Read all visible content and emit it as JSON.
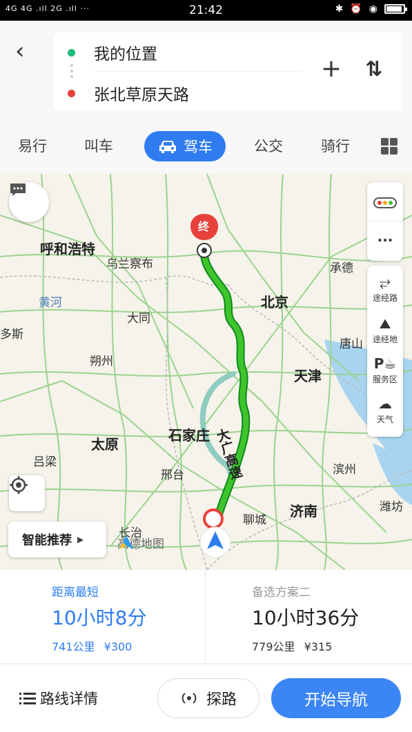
{
  "status_bar": {
    "network": "4G 4G .ıll 2G .ıll ···",
    "time": "21:42",
    "icons": [
      "bluetooth-icon",
      "alarm-icon",
      "location-icon",
      "battery-icon"
    ],
    "battery_level": 0.9
  },
  "route": {
    "from": "我的位置",
    "to": "张北草原天路",
    "from_color": "#1ebc7a",
    "to_color": "#e8403a"
  },
  "modes": {
    "items": [
      "易行",
      "叫车",
      "驾车",
      "公交",
      "骑行"
    ],
    "active": "驾车"
  },
  "map": {
    "cities": [
      {
        "name": "呼和浩特",
        "big": true
      },
      {
        "name": "乌兰察布",
        "big": false
      },
      {
        "name": "承德",
        "big": false
      },
      {
        "name": "黄河",
        "big": false,
        "river": true
      },
      {
        "name": "大同",
        "big": false
      },
      {
        "name": "北京",
        "big": true
      },
      {
        "name": "多斯",
        "big": false
      },
      {
        "name": "唐山",
        "big": false
      },
      {
        "name": "朔州",
        "big": false
      },
      {
        "name": "天津",
        "big": true
      },
      {
        "name": "石家庄",
        "big": true
      },
      {
        "name": "太原",
        "big": true
      },
      {
        "name": "吕梁",
        "big": false
      },
      {
        "name": "滨州",
        "big": false
      },
      {
        "name": "邢台",
        "big": false
      },
      {
        "name": "济南",
        "big": true
      },
      {
        "name": "潍坊",
        "big": false
      },
      {
        "name": "聊城",
        "big": false
      },
      {
        "name": "长治",
        "big": false
      }
    ],
    "highway_label": "大广高速",
    "end_marker": "终",
    "panel": {
      "items": [
        {
          "label": "途经路",
          "icon": "waypoint-road-icon"
        },
        {
          "label": "途经地",
          "icon": "waypoint-place-icon"
        },
        {
          "label": "服务区",
          "icon": "service-area-icon"
        },
        {
          "label": "天气",
          "icon": "weather-icon"
        }
      ]
    },
    "smart_recommend": "智能推荐",
    "logo_text": "高德地图"
  },
  "options": [
    {
      "label": "距离最短",
      "duration": "10小时8分",
      "distance": "741公里",
      "toll": "¥300",
      "selected": true
    },
    {
      "label": "备选方案二",
      "duration": "10小时36分",
      "distance": "779公里",
      "toll": "¥315",
      "selected": false
    }
  ],
  "actions": {
    "details": "路线详情",
    "probe": "探路",
    "start": "开始导航"
  }
}
